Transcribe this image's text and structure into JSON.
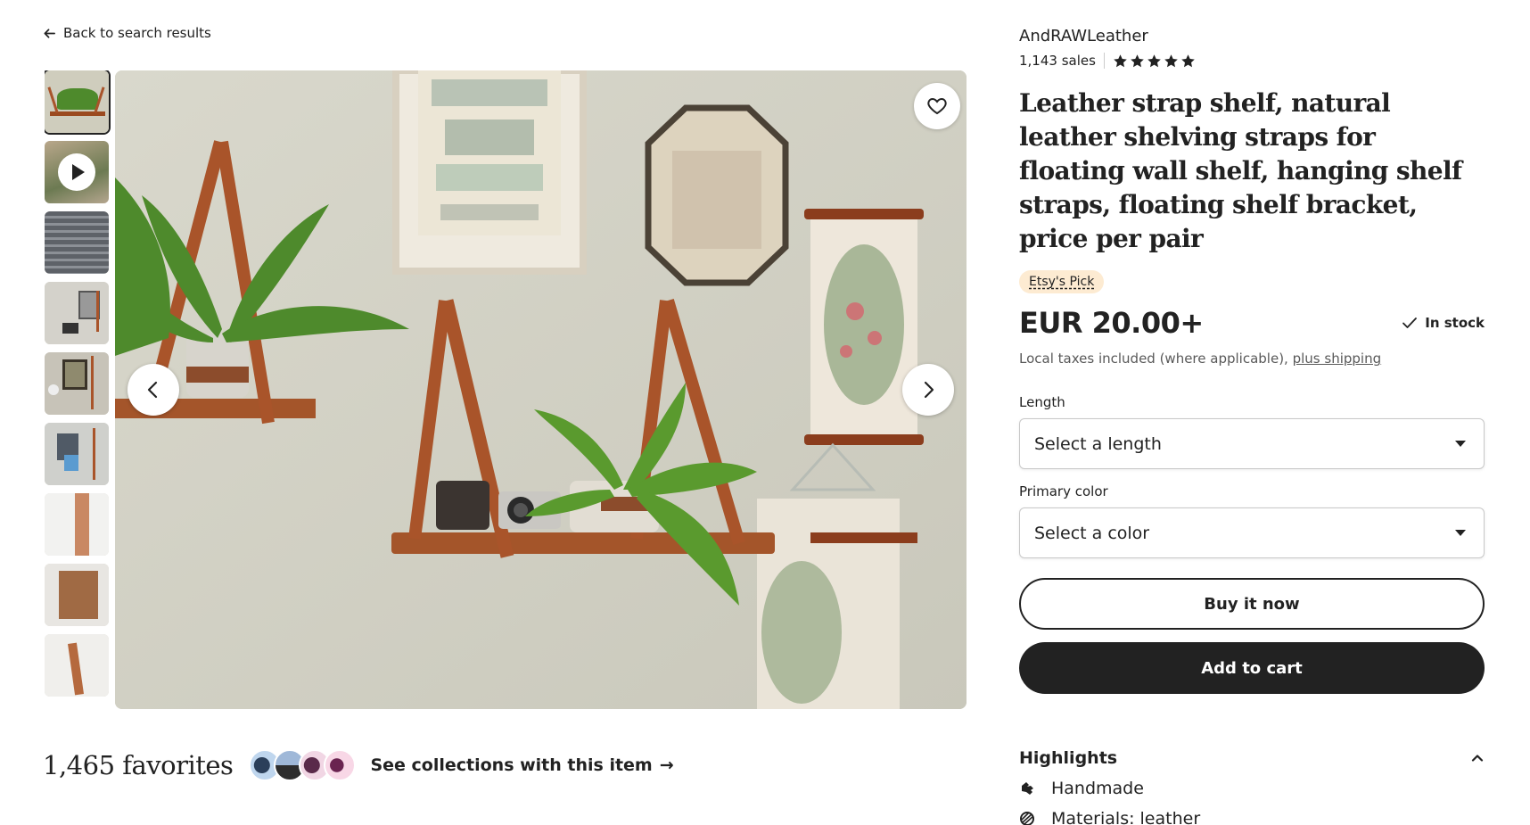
{
  "nav": {
    "back_label": "Back to search results"
  },
  "gallery": {
    "thumbnail_count": 9,
    "favorite_label": "Add to favorites",
    "prev_label": "Previous image",
    "next_label": "Next image"
  },
  "social": {
    "favorites": "1,465 favorites",
    "collections_link": "See collections with this item",
    "arrow": "→"
  },
  "shop": {
    "name": "AndRAWLeather",
    "sales": "1,143 sales",
    "rating": 5
  },
  "product": {
    "title": "Leather strap shelf, natural leather shelving straps for floating wall shelf, hanging shelf straps, floating shelf bracket, price per pair",
    "badge": "Etsy's Pick",
    "price": "EUR 20.00+",
    "stock": "In stock",
    "tax_note": "Local taxes included (where applicable),",
    "shipping_link": "plus shipping"
  },
  "options": {
    "length_label": "Length",
    "length_placeholder": "Select a length",
    "color_label": "Primary color",
    "color_placeholder": "Select a color"
  },
  "actions": {
    "buy_now": "Buy it now",
    "add_to_cart": "Add to cart"
  },
  "highlights": {
    "heading": "Highlights",
    "items": [
      {
        "label": "Handmade",
        "icon": "hand-icon"
      },
      {
        "label": "Materials: leather",
        "icon": "materials-icon"
      }
    ]
  },
  "colors": {
    "text": "#222222",
    "muted": "#595959",
    "badge_bg": "#fdebd2",
    "leather": "#a9542a"
  }
}
